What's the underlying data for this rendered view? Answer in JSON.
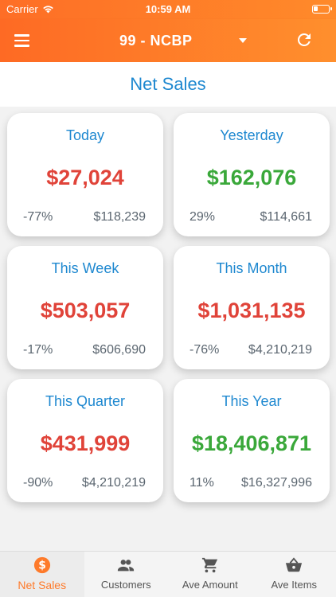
{
  "status_bar": {
    "carrier": "Carrier",
    "time": "10:59 AM"
  },
  "app_bar": {
    "store": "99 - NCBP"
  },
  "page": {
    "title": "Net Sales"
  },
  "colors": {
    "accent": "#fe7a2a",
    "title_blue": "#1e88d0",
    "negative": "#e04339",
    "positive": "#3aa83a"
  },
  "cards": [
    {
      "title": "Today",
      "value": "$27,024",
      "pct": "-77%",
      "prev": "$118,239",
      "trend": "down"
    },
    {
      "title": "Yesterday",
      "value": "$162,076",
      "pct": "29%",
      "prev": "$114,661",
      "trend": "up"
    },
    {
      "title": "This Week",
      "value": "$503,057",
      "pct": "-17%",
      "prev": "$606,690",
      "trend": "down"
    },
    {
      "title": "This Month",
      "value": "$1,031,135",
      "pct": "-76%",
      "prev": "$4,210,219",
      "trend": "down"
    },
    {
      "title": "This Quarter",
      "value": "$431,999",
      "pct": "-90%",
      "prev": "$4,210,219",
      "trend": "down"
    },
    {
      "title": "This Year",
      "value": "$18,406,871",
      "pct": "11%",
      "prev": "$16,327,996",
      "trend": "up"
    }
  ],
  "tabs": [
    {
      "label": "Net Sales",
      "icon": "dollar-icon",
      "active": true
    },
    {
      "label": "Customers",
      "icon": "people-icon",
      "active": false
    },
    {
      "label": "Ave Amount",
      "icon": "cart-icon",
      "active": false
    },
    {
      "label": "Ave Items",
      "icon": "basket-icon",
      "active": false
    }
  ]
}
